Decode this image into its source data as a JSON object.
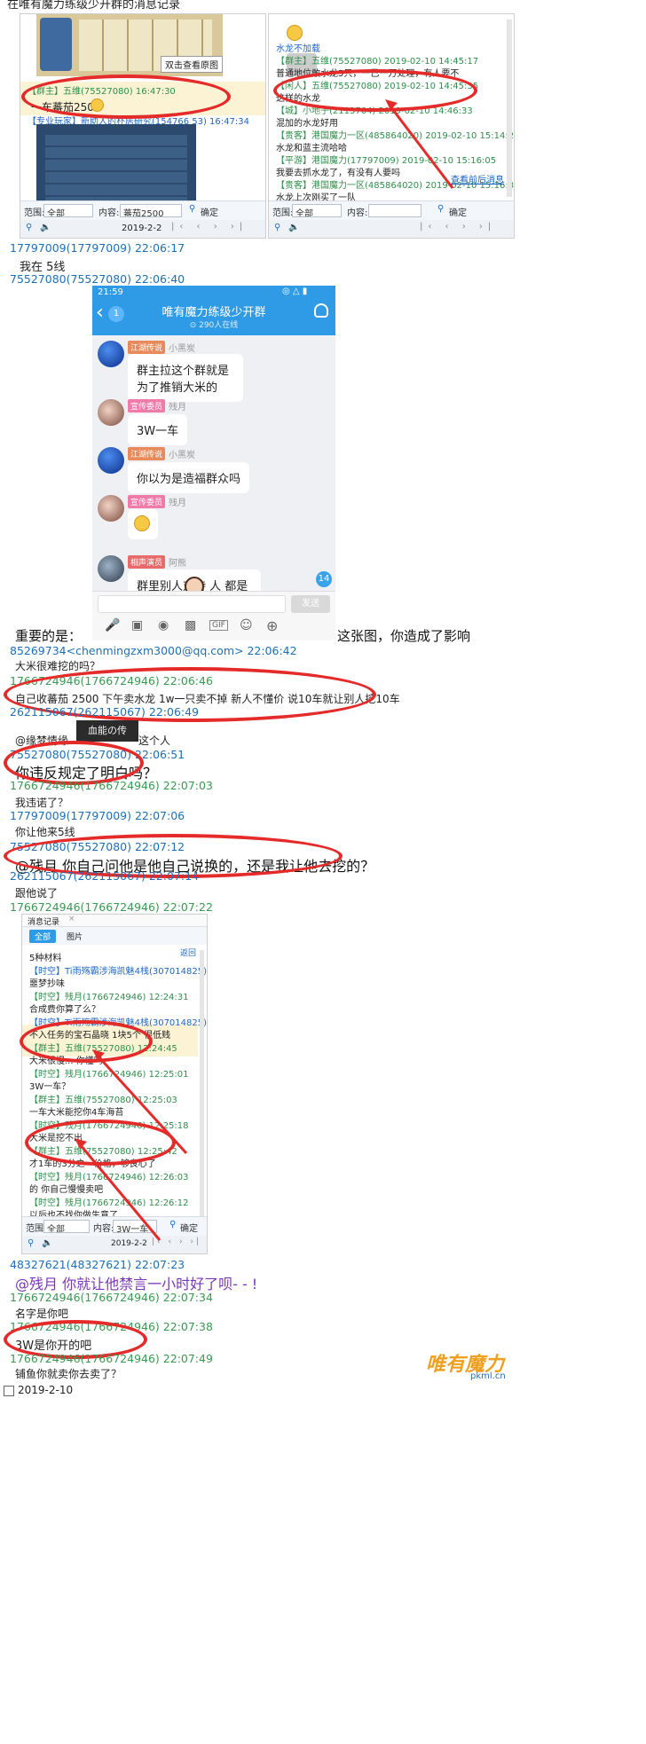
{
  "top_caption": "在唯有魔力练级少开群的消息记录",
  "shot1": {
    "tooltip": "双击查看原图",
    "left_header": "【群主】五维(75527080) 16:47:30",
    "left_msg": "一车蕃茄2500",
    "left_header2": "【专业玩家】新助人的朴居研究(154766 53) 16:47:34",
    "right_lines": [
      {
        "cls": "c-blue",
        "text": "水龙不加载"
      },
      {
        "cls": "c-green",
        "text": "【群主】五维(75527080) 2019-02-10 14:45:17"
      },
      {
        "cls": "c-text",
        "text": "普通地位敢水龙5只，一已一万处理，有人要不"
      },
      {
        "cls": "c-green",
        "text": "【闲人】五维(75527080) 2019-02-10 14:45:35"
      },
      {
        "cls": "c-text",
        "text": "这样的水龙"
      },
      {
        "cls": "c-green",
        "text": "【城】小地子(2113704) 2019-02-10 14:46:33"
      },
      {
        "cls": "c-text",
        "text": "混加的水龙好用"
      },
      {
        "cls": "c-green",
        "text": "【贵客】港国魔力一区(485864020) 2019-02-10 15:14:24"
      },
      {
        "cls": "c-text",
        "text": "水龙和蓝主流哈哈"
      },
      {
        "cls": "c-green",
        "text": "【平游】港国魔力(17797009) 2019-02-10 15:16:05"
      },
      {
        "cls": "c-text",
        "text": "我要去抓水龙了，有没有人要吗"
      },
      {
        "cls": "c-green",
        "text": "【贵客】港国魔力一区(485864020) 2019-02-10 15:16:32"
      },
      {
        "cls": "c-text",
        "text": "水龙上次刚买了一队"
      }
    ],
    "right_link": "查看前后消息",
    "left_range_label": "范围:",
    "left_range_value": "全部",
    "left_content_label": "内容:",
    "left_content_value": "蕃茄2500",
    "right_range_label": "范围:",
    "right_range_value": "全部",
    "right_content_label": "内容:",
    "search_btn": "确定",
    "date": "2019-2-2"
  },
  "log1": {
    "h1": "17797009(17797009) 22:06:17",
    "m1": "我在 5线",
    "h2": "75527080(75527080) 22:06:40"
  },
  "phone": {
    "time": "21:59",
    "badge": "1",
    "title": "唯有魔力练级少开群",
    "subtitle": "⊙ 290人在线",
    "msgs": [
      {
        "tag": "江湖传说",
        "name": "小黑炭",
        "text": "群主拉这个群就是为了推销大米的"
      },
      {
        "tag": "宣传委员",
        "name": "残月",
        "text": "3W一车"
      },
      {
        "tag": "江湖传说",
        "name": "小黑炭",
        "text": "你以为是造福群众吗"
      },
      {
        "tag": "宣传委员",
        "name": "残月",
        "text": ""
      },
      {
        "tag": "相声演员",
        "name": "阿熊",
        "text": "群里别人对待 人 都是赞助"
      }
    ],
    "float_count": "14",
    "send": "发送"
  },
  "log2": {
    "important": "重要的是：",
    "important_tail": "这张图，你造成了影响",
    "h3": "85269734<chenmingzxm3000@qq.com> 22:06:42",
    "m3": "大米很难挖的吗？",
    "h4": "1766724946(1766724946) 22:06:46",
    "m4": "自己收蕃茄 2500 下午卖水龙 1w一只卖不掉 新人不懂价 说10车就让别人挖10车",
    "h5": "262115067(262115067) 22:06:49",
    "sticker": "血能の传",
    "m5": "@缘梦情缘 ",
    "m5_tail": "这个人",
    "h6": "75527080(75527080) 22:06:51",
    "m6": "你违反规定了明白吗？",
    "h7": "1766724946(1766724946) 22:07:03",
    "m7": "我违诺了？",
    "h8": "17797009(17797009) 22:07:06",
    "m8": "你让他来5线",
    "h9": "75527080(75527080) 22:07:12",
    "m9": "@残月 你自己问他是他自己说换的，还是我让他去挖的？",
    "h10": "262115067(262115067) 22:07:14",
    "m10": "跟他说了",
    "h11": "1766724946(1766724946) 22:07:22"
  },
  "shot2": {
    "title": "消息记录",
    "tab_all": "全部",
    "tab_img": "图片",
    "back": "返回",
    "lines": [
      {
        "cls": "c-text",
        "text": "5种材料"
      },
      {
        "cls": "c-blue",
        "text": "【时空】Ti雨殇霸涉海凯魅4栈(307014825) 12:24:26"
      },
      {
        "cls": "c-text",
        "text": "噩梦抄味"
      },
      {
        "cls": "c-green",
        "text": "【时空】残月(1766724946) 12:24:31"
      },
      {
        "cls": "c-text",
        "text": "合成费你算了么？"
      },
      {
        "cls": "c-blue",
        "text": "【时空】Ti雨殇霸涉海凯魅4栈(307014825) 12:24:45"
      },
      {
        "cls": "c-text",
        "text": "不入任务的宝石晶晓  1块5个  很低贱"
      },
      {
        "cls": "c-green",
        "text": "【群主】五维(75527080) 12:24:45"
      },
      {
        "cls": "c-text",
        "text": "大米很慢...  你懂吗"
      },
      {
        "cls": "c-green",
        "text": "【时空】残月(1766724946) 12:25:01"
      },
      {
        "cls": "c-text",
        "text": "3W一车？"
      },
      {
        "cls": "c-green",
        "text": "【群主】五维(75527080) 12:25:03"
      },
      {
        "cls": "c-text",
        "text": "一车大米能挖你4车海苔"
      },
      {
        "cls": "c-green",
        "text": "【时空】残月(1766724946) 12:25:18"
      },
      {
        "cls": "c-text",
        "text": "大米是挖不出"
      },
      {
        "cls": "c-green",
        "text": "【群主】五维(75527080) 12:25:42"
      },
      {
        "cls": "c-text",
        "text": "才1车的3分之一价格，够良心了"
      },
      {
        "cls": "c-green",
        "text": "【时空】残月(1766724946) 12:26:03"
      },
      {
        "cls": "c-text",
        "text": "的 你自己慢慢卖吧"
      },
      {
        "cls": "c-green",
        "text": "【时空】残月(1766724946) 12:26:12"
      },
      {
        "cls": "c-text",
        "text": "以后也不找你做生意了"
      },
      {
        "cls": "c-green",
        "text": "【群主】五维(75527080) 12:26:32"
      }
    ],
    "range_label": "范围:",
    "range_value": "全部",
    "content_label": "内容:",
    "content_value": "3W一车",
    "search_btn": "确定",
    "date": "2019-2-2"
  },
  "log3": {
    "h12": "48327621(48327621) 22:07:23",
    "m12": "@残月 你就让他禁言一小时好了呗- - !",
    "h13": "1766724946(1766724946) 22:07:34",
    "m13": "名字是你吧",
    "h14": "1766724946(1766724946) 22:07:38",
    "m14": "3W是你开的吧",
    "h15": "1766724946(1766724946) 22:07:49",
    "m15": "铺鱼你就卖你去卖了？"
  },
  "footer": {
    "date": "2019-2-10",
    "logo_main": "唯有魔力",
    "logo_url": "pkml.cn"
  }
}
